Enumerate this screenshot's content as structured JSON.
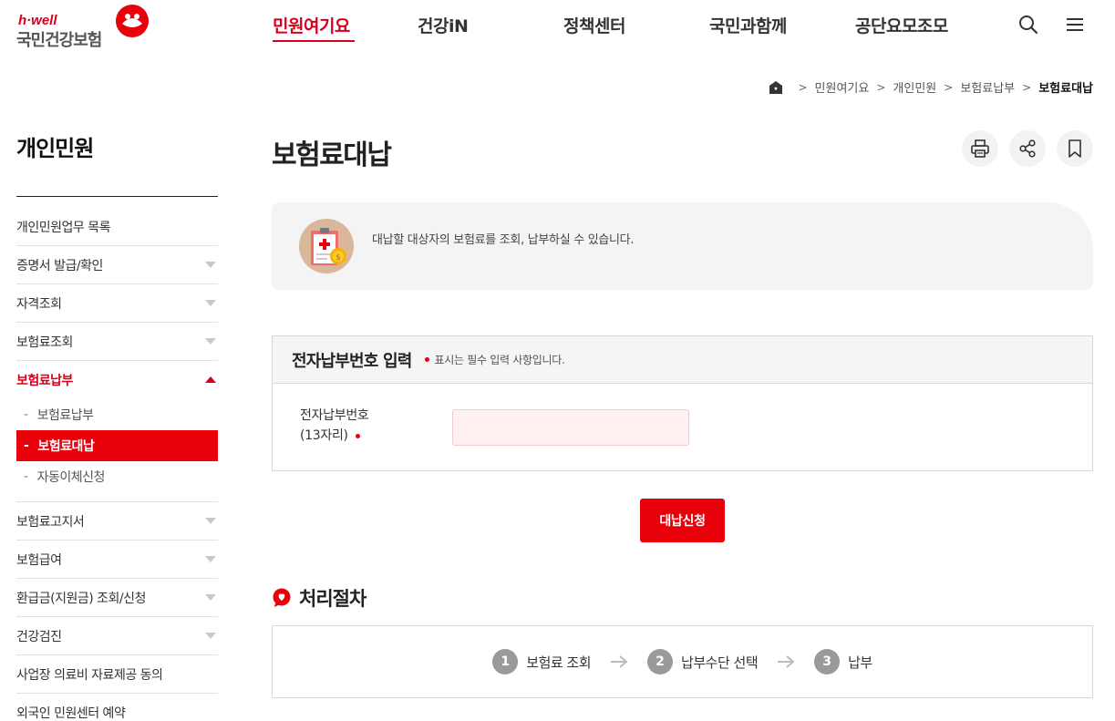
{
  "header": {
    "logo_tag": "h·well",
    "logo_name": "국민건강보험",
    "nav": [
      {
        "label": "민원여기요",
        "active": true
      },
      {
        "label": "건강iN"
      },
      {
        "label": "정책센터"
      },
      {
        "label": "국민과함께"
      },
      {
        "label": "공단요모조모"
      }
    ],
    "icons": [
      "search-icon",
      "menu-icon"
    ]
  },
  "breadcrumb": {
    "items": [
      "민원여기요",
      "개인민원",
      "보험료납부",
      "보험료대납"
    ]
  },
  "sidebar": {
    "title": "개인민원",
    "items": [
      {
        "label": "개인민원업무 목록"
      },
      {
        "label": "증명서 발급/확인"
      },
      {
        "label": "자격조회"
      },
      {
        "label": "보험료조회"
      },
      {
        "label": "보험료납부"
      },
      {
        "label": "보험료고지서"
      },
      {
        "label": "보험급여"
      },
      {
        "label": "환급금(지원금) 조회/신청"
      },
      {
        "label": "건강검진"
      },
      {
        "label": "사업장 의료비 자료제공 동의"
      },
      {
        "label": "외국인 민원센터 예약"
      }
    ],
    "sub_items": [
      {
        "label": "보험료납부"
      },
      {
        "label": "보험료대납"
      },
      {
        "label": "자동이체신청"
      }
    ]
  },
  "main": {
    "title": "보험료대납",
    "tools": [
      "print-icon",
      "share-icon",
      "bookmark-icon"
    ],
    "intro": "대납할 대상자의 보험료를 조회, 납부하실 수 있습니다.",
    "form": {
      "heading": "전자납부번호 입력",
      "required_note": "표시는 필수 입력 사항입니다.",
      "label_line1": "전자납부번호",
      "label_line2": "(13자리)",
      "input_value": "",
      "input_placeholder": ""
    },
    "submit_label": "대납신청",
    "process": {
      "title": "처리절차",
      "steps": [
        {
          "num": "1",
          "label": "보험료 조회"
        },
        {
          "num": "2",
          "label": "납부수단 선택"
        },
        {
          "num": "3",
          "label": "납부"
        }
      ]
    }
  },
  "colors": {
    "accent": "#e8000b",
    "brand_red": "#d6001c",
    "step_gray": "#9a9a9a"
  }
}
